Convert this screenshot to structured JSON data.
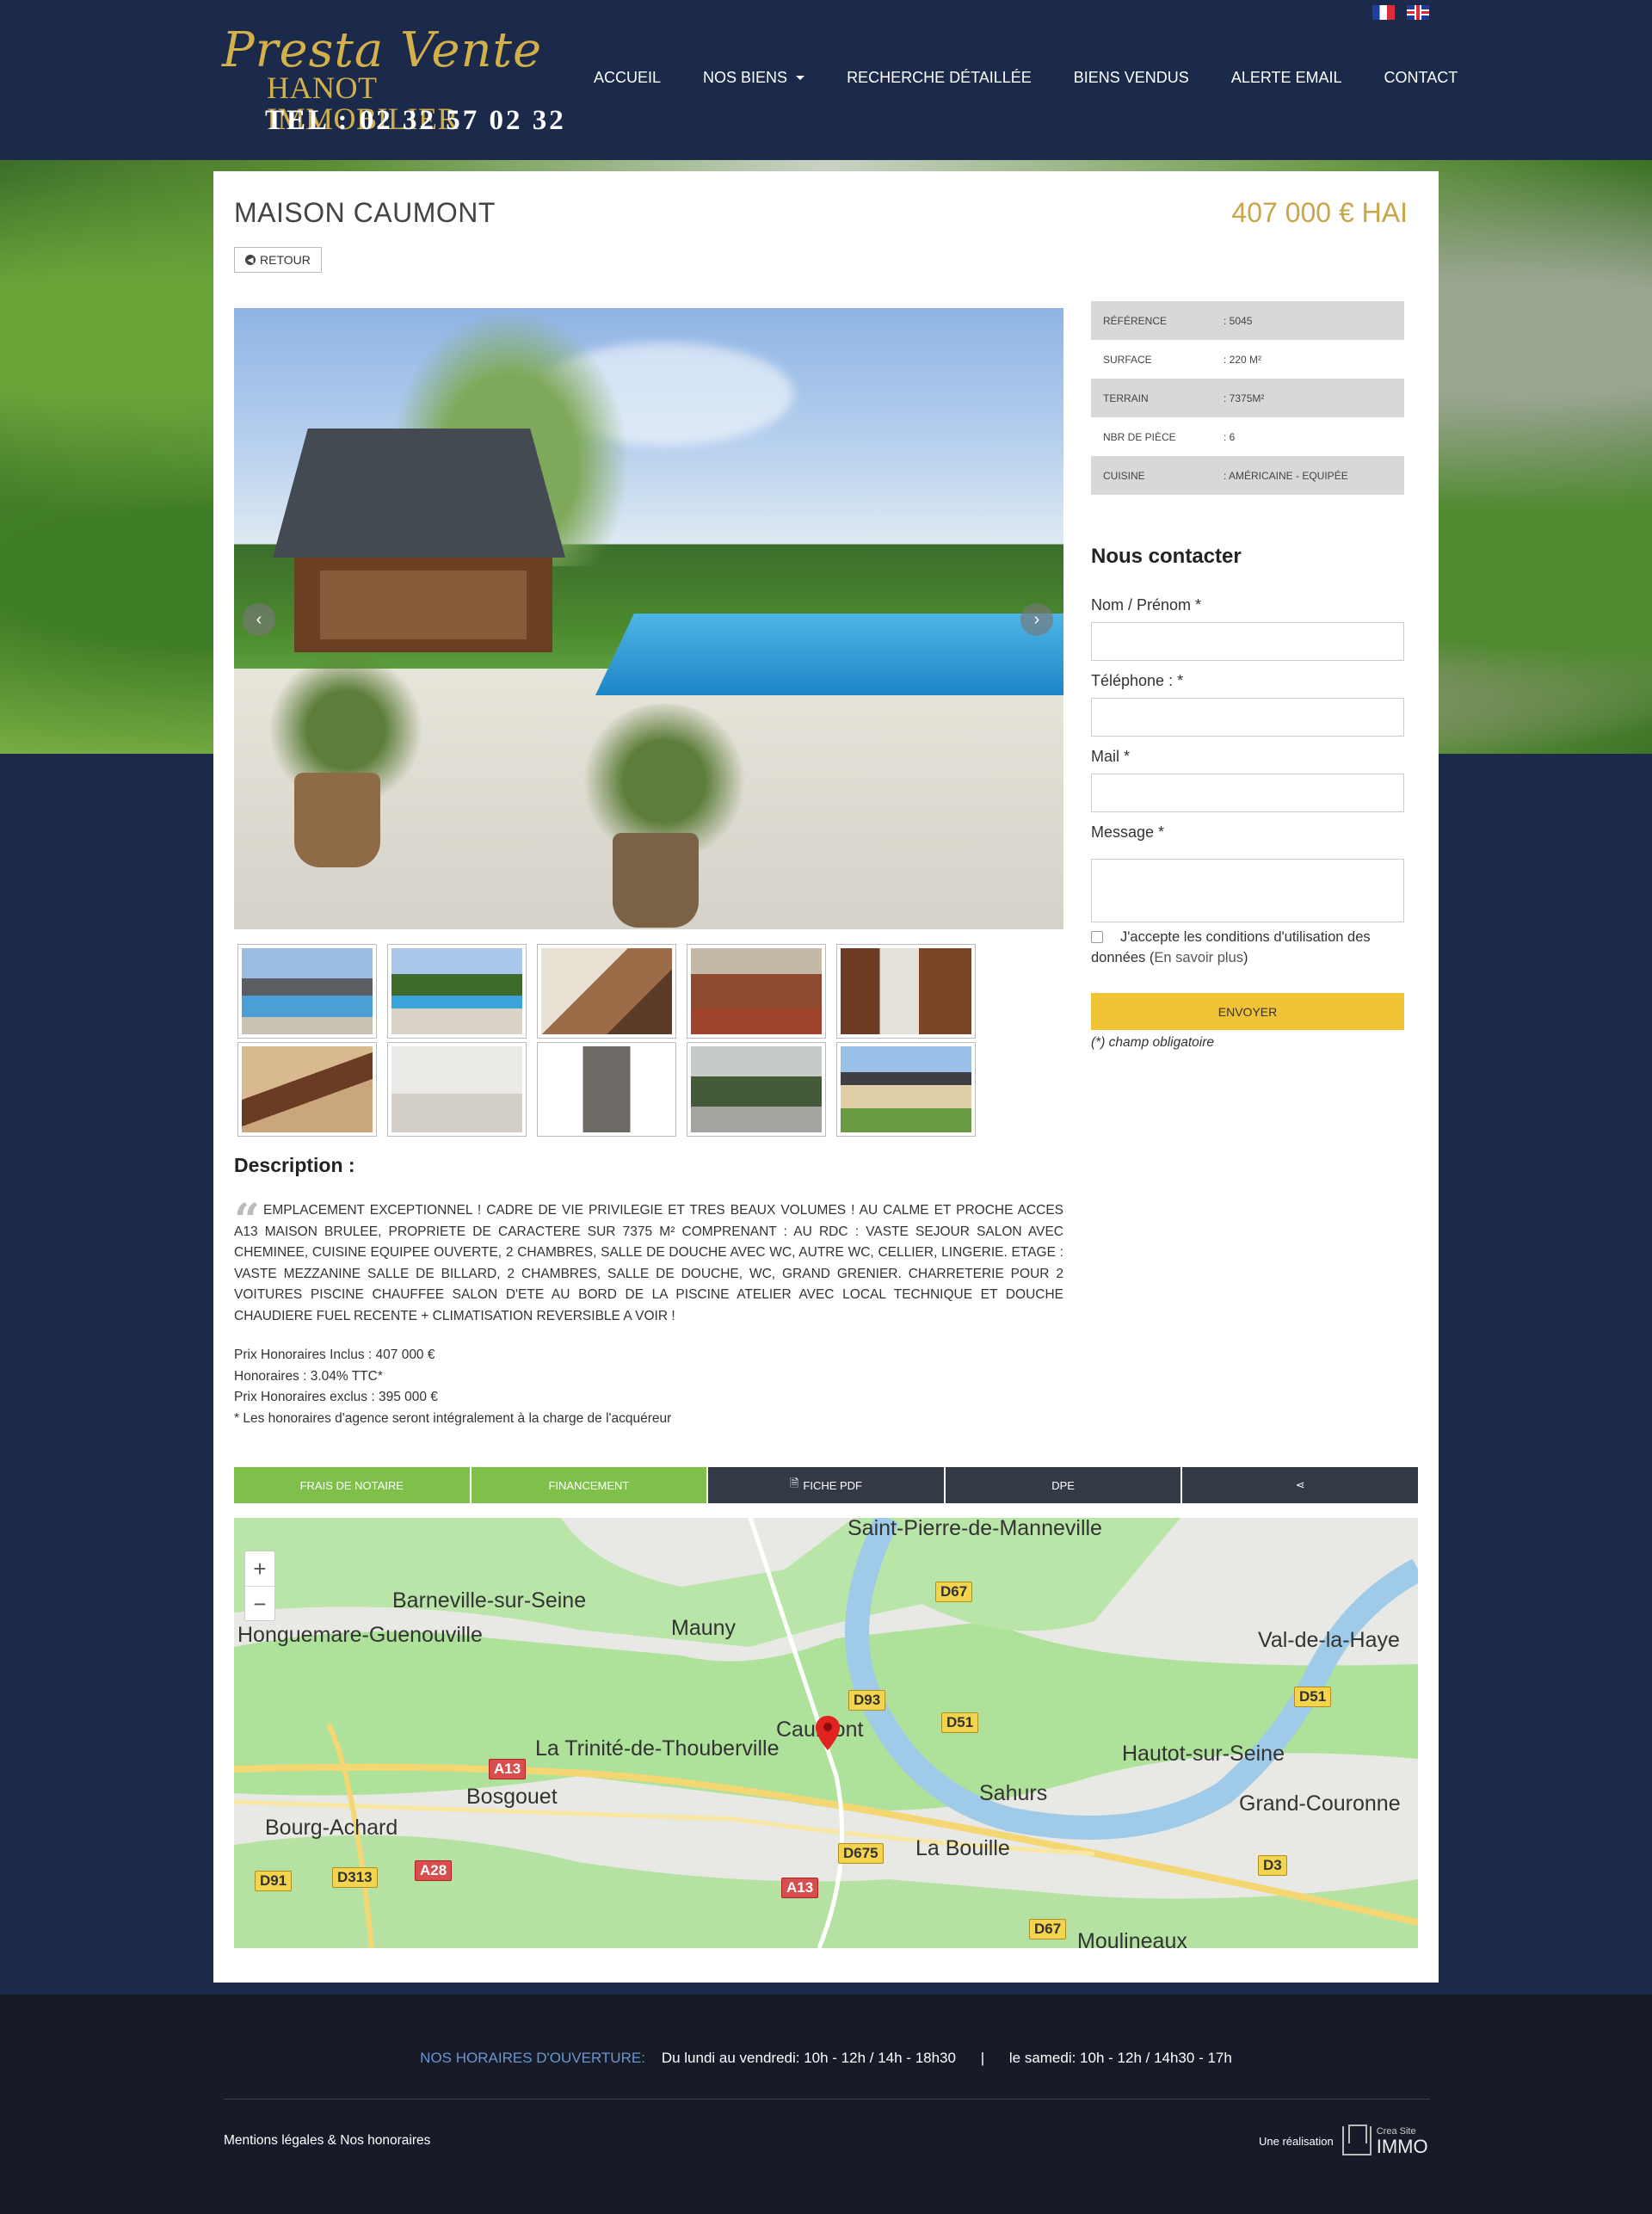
{
  "header": {
    "logo_script": "Presta Vente",
    "logo_name": "HANOT IMMOBILIER",
    "logo_tel": "TEL : 02 32 57 02 32",
    "nav": [
      "ACCUEIL",
      "NOS BIENS",
      "RECHERCHE DÉTAILLÉE",
      "BIENS VENDUS",
      "ALERTE EMAIL",
      "CONTACT"
    ],
    "flags": [
      "fr-flag-icon",
      "uk-flag-icon"
    ]
  },
  "listing": {
    "title": "MAISON CAUMONT",
    "price": "407 000 € HAI",
    "back_label": "RETOUR",
    "thumbnails_count": 10,
    "info": [
      {
        "k": "RÉFÉRENCE",
        "v": ": 5045"
      },
      {
        "k": "SURFACE",
        "v": ": 220 M²"
      },
      {
        "k": "TERRAIN",
        "v": ": 7375M²"
      },
      {
        "k": "NBR DE PIÈCE",
        "v": ": 6"
      },
      {
        "k": "CUISINE",
        "v": ": AMÉRICAINE - EQUIPÉE"
      }
    ],
    "description_title": "Description :",
    "description": "EMPLACEMENT EXCEPTIONNEL ! CADRE DE VIE PRIVILEGIE ET TRES BEAUX VOLUMES ! AU CALME et PROCHE ACCES A13 MAISON BRULEE, PROPRIETE DE CARACTERE SUR 7375 M² COMPRENANT : AU RDC : VASTE SEJOUR SALON AVEC CHEMINEE, CUISINE EQUIPEE OUVERTE, 2 CHAMBRES, SALLE DE DOUCHE AVEC WC, AUTRE WC, CELLIER, LINGERIE. ETAGE : VASTE MEZZANINE SALLE DE BILLARD, 2 CHAMBRES, SALLE DE DOUCHE, WC, GRAND GRENIER. CHARRETERIE POUR 2 VOITURES PISCINE CHAUFFEE SALON D'ETE AU BORD DE LA PISCINE ATELIER AVEC LOCAL TECHNIQUE ET DOUCHE CHAUDIERE FUEL RECENTE + CLIMATISATION REVERSIBLE A VOIR !",
    "fees": [
      "Prix Honoraires Inclus : 407 000 €",
      "Honoraires : 3.04% TTC*",
      "Prix Honoraires exclus : 395 000 €",
      "* Les honoraires d'agence seront intégralement à la charge de l'acquéreur"
    ],
    "actions": [
      "FRAIS DE NOTAIRE",
      "FINANCEMENT",
      "FICHE PDF",
      "DPE",
      ""
    ]
  },
  "contact": {
    "title": "Nous contacter",
    "name_label": "Nom / Prénom *",
    "phone_label": "Téléphone : *",
    "mail_label": "Mail *",
    "message_label": "Message *",
    "consent_text": "J'accepte les conditions d'utilisation des données (",
    "consent_link": "En savoir plus",
    "consent_end": ")",
    "send": "ENVOYER",
    "mandatory": "(*) champ obligatoire"
  },
  "map": {
    "places": [
      "Saint-Pierre-de-Manneville",
      "Barneville-sur-Seine",
      "Honguemare-Guenouville",
      "Mauny",
      "Val-de-la-Haye",
      "Caumont",
      "La Trinité-de-Thouberville",
      "Hautot-sur-Seine",
      "Sahurs",
      "Grand-Couronne",
      "Bosgouet",
      "Bourg-Achard",
      "La Bouille",
      "Moulineaux"
    ],
    "roads": [
      "D67",
      "D93",
      "D51",
      "D51",
      "A13",
      "D675",
      "A28",
      "D313",
      "D91",
      "A13",
      "D3",
      "D67"
    ],
    "zoom_in": "+",
    "zoom_out": "−"
  },
  "footer": {
    "hours_label": "NOS HORAIRES D'OUVERTURE:",
    "weekday": "Du lundi au vendredi: 10h - 12h / 14h - 18h30",
    "separator": "|",
    "saturday": "le samedi: 10h - 12h / 14h30 - 17h",
    "legal": "Mentions légales & Nos honoraires",
    "credit_prefix": "Une réalisation",
    "credit_top": "Crea Site",
    "credit_brand": "IMMO"
  }
}
